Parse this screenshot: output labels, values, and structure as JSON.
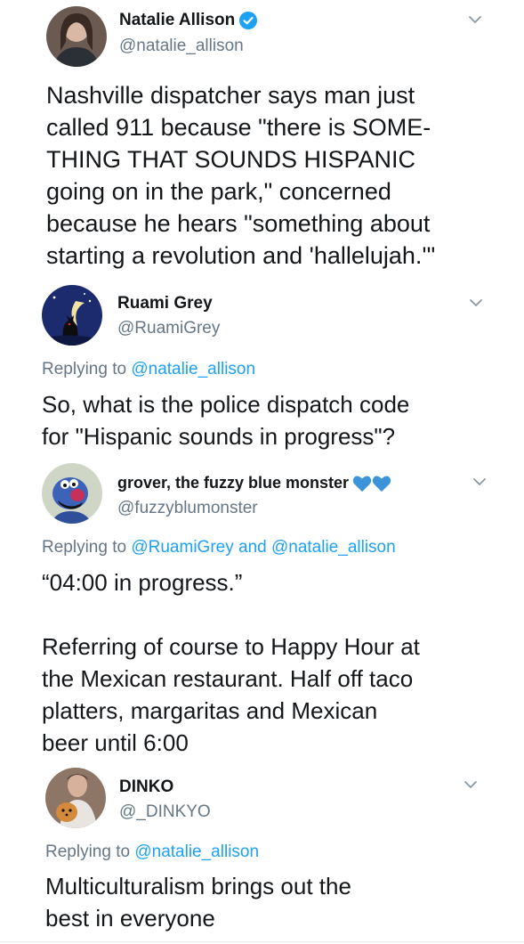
{
  "tweets": [
    {
      "name": "Natalie Allison",
      "handle": "@natalie_allison",
      "verified": true,
      "text": "Nashville dispatcher says man just\ncalled 911 because \"there is SOME-\nTHING THAT SOUNDS HISPANIC\ngoing on in the park,\" concerned\nbecause he hears \"something about\nstarting a revolution and 'hallelujah.'\""
    },
    {
      "name": "Ruami Grey",
      "handle": "@RuamiGrey",
      "reply_prefix": "Replying to",
      "reply_to": "@natalie_allison",
      "text": "So, what is the police dispatch code\nfor \"Hispanic sounds in progress\"?"
    },
    {
      "name": "grover, the fuzzy blue monster",
      "handle": "@fuzzyblumonster",
      "reply_prefix": "Replying to",
      "reply_to_1": "@RuamiGrey",
      "reply_and": "and",
      "reply_to_2": "@natalie_allison",
      "text": "“04:00 in progress.”\n\nReferring of course to Happy Hour  at\nthe Mexican restaurant. Half off taco\nplatters, margaritas and Mexican\nbeer until 6:00"
    },
    {
      "name": "DINKO",
      "handle": "@_DINKYO",
      "reply_prefix": "Replying to",
      "reply_to": "@natalie_allison",
      "text": "Multiculturalism brings out the\nbest in everyone"
    }
  ],
  "colors": {
    "text": "#14171a",
    "secondary": "#657786",
    "link": "#1da1f2",
    "verified": "#1da1f2",
    "heart": "#3b94d9"
  },
  "icons": {
    "verified": "verified-badge-icon",
    "chevron": "chevron-down-icon",
    "heart": "blue-heart-icon"
  }
}
